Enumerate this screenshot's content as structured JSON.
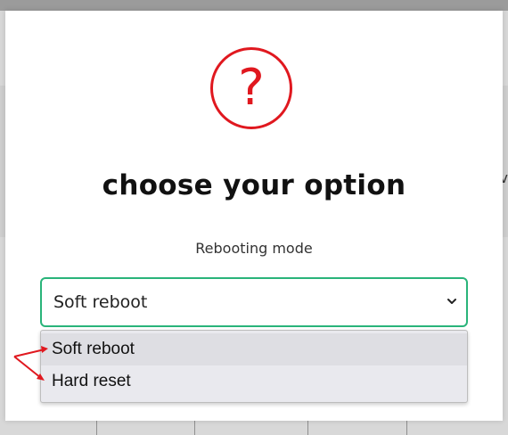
{
  "backdrop": {
    "edge_letter": "v"
  },
  "dialog": {
    "icon": "question-mark-circle-icon",
    "icon_glyph": "?",
    "title": "choose your option",
    "field_label": "Rebooting mode",
    "select": {
      "selected_value": "Soft reboot",
      "icon": "chevron-down-icon",
      "options": [
        {
          "label": "Soft reboot"
        },
        {
          "label": "Hard reset"
        }
      ]
    }
  },
  "colors": {
    "icon_red": "#e0181f",
    "select_border": "#29b47a",
    "annotation_red": "#e0181f"
  }
}
